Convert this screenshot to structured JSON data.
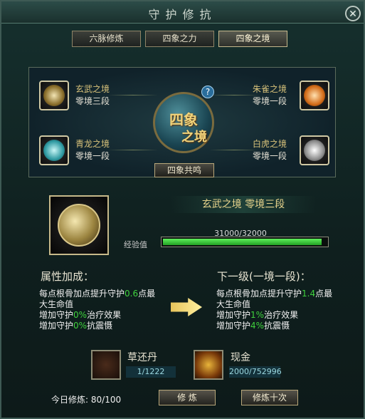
{
  "window": {
    "title": "守护修抗",
    "close_label": "✕"
  },
  "tabs": [
    {
      "label": "六脉修炼"
    },
    {
      "label": "四象之力"
    },
    {
      "label": "四象之境"
    }
  ],
  "panel": {
    "center_line1": "四象",
    "center_line2": "之境",
    "help_label": "?",
    "resonance_label": "四象共鸣",
    "slots": [
      {
        "name": "玄武之境",
        "level": "零境三段"
      },
      {
        "name": "青龙之境",
        "level": "零境一段"
      },
      {
        "name": "朱雀之境",
        "level": "零境一段"
      },
      {
        "name": "白虎之境",
        "level": "零境一段"
      }
    ]
  },
  "selected": {
    "stage_text": "玄武之境  零境三段",
    "exp_label": "经验值",
    "exp_text": "31000/32000",
    "exp_progress": 0.97
  },
  "current": {
    "title": "属性加成：",
    "l1_prefix": "每点根骨加点提升守护",
    "l1_value": "0.6",
    "l1_suffix": "点最",
    "l2": "大生命值",
    "l3_prefix": "增加守护",
    "l3_value": "0%",
    "l3_suffix": "治疗效果",
    "l4_prefix": "增加守护",
    "l4_value": "0%",
    "l4_suffix": "抗震慑"
  },
  "next": {
    "title": "下一级(一境一段)：",
    "l1_prefix": "每点根骨加点提升守护",
    "l1_value": "1.4",
    "l1_suffix": "点最",
    "l2": "大生命值",
    "l3_prefix": "增加守护",
    "l3_value": "1%",
    "l3_suffix": "治疗效果",
    "l4_prefix": "增加守护",
    "l4_value": "4%",
    "l4_suffix": "抗震慑"
  },
  "materials": [
    {
      "name": "草还丹",
      "count": "1/1222"
    },
    {
      "name": "现金",
      "count": "2000/752996"
    }
  ],
  "footer": {
    "today_label": "今日修炼:",
    "today_value": "80/100",
    "train_label": "修 炼",
    "train10_label": "修炼十次"
  }
}
